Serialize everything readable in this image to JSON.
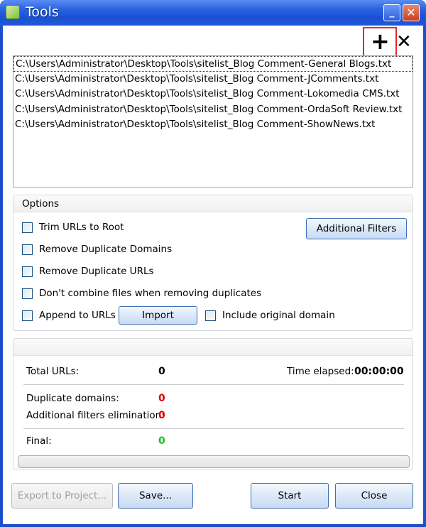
{
  "window": {
    "title": "Tools",
    "minimize_glyph": "_",
    "close_glyph": "✕"
  },
  "toolbar": {
    "add_glyph": "+",
    "remove_glyph": "✕",
    "add_icon": "plus-icon",
    "remove_icon": "close-icon"
  },
  "files": [
    "C:\\Users\\Administrator\\Desktop\\Tools\\sitelist_Blog Comment-General Blogs.txt",
    "C:\\Users\\Administrator\\Desktop\\Tools\\sitelist_Blog Comment-JComments.txt",
    "C:\\Users\\Administrator\\Desktop\\Tools\\sitelist_Blog Comment-Lokomedia CMS.txt",
    "C:\\Users\\Administrator\\Desktop\\Tools\\sitelist_Blog Comment-OrdaSoft Review.txt",
    "C:\\Users\\Administrator\\Desktop\\Tools\\sitelist_Blog Comment-ShowNews.txt"
  ],
  "options": {
    "title": "Options",
    "trim_root": "Trim URLs to Root",
    "remove_dup_domains": "Remove Duplicate Domains",
    "remove_dup_urls": "Remove Duplicate URLs",
    "dont_combine": "Don't combine files when removing duplicates",
    "append_urls": "Append to URLs",
    "import_label": "Import",
    "include_domain": "Include original domain",
    "additional_filters": "Additional Filters"
  },
  "stats": {
    "total_urls_label": "Total URLs:",
    "total_urls_value": "0",
    "time_elapsed_label": "Time elapsed:",
    "time_elapsed_value": "00:00:00",
    "dup_domains_label": "Duplicate domains:",
    "dup_domains_value": "0",
    "additional_filters_label": "Additional filters elimination:",
    "additional_filters_value": "0",
    "final_label": "Final:",
    "final_value": "0",
    "progress": 0
  },
  "buttons": {
    "export": "Export to Project...",
    "save": "Save...",
    "start": "Start",
    "close": "Close"
  },
  "colors": {
    "title_bar": "#2a63e0",
    "highlight_box": "#e02b2b",
    "value_red": "#e00000",
    "value_green": "#19c219"
  }
}
